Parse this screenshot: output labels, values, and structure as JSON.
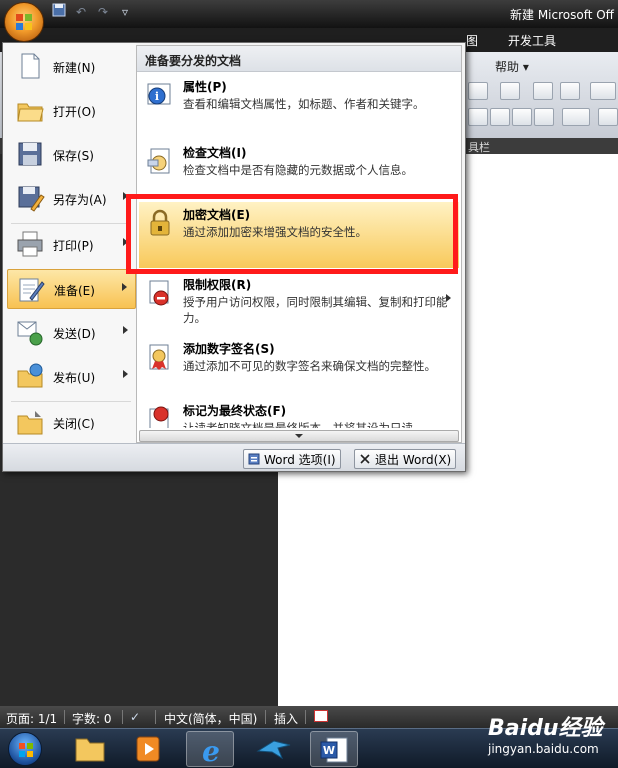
{
  "window": {
    "title": "新建 Microsoft Off",
    "quick_access": [
      "save-icon",
      "undo-icon",
      "redo-icon",
      "customize-icon"
    ]
  },
  "ribbon": {
    "tabs": [
      "图",
      "开发工具"
    ],
    "help_label": "帮助",
    "group_label": "具栏"
  },
  "office_menu": {
    "left_items": [
      {
        "label": "新建(N)",
        "icon": "new-document-icon",
        "has_submenu": false
      },
      {
        "label": "打开(O)",
        "icon": "open-folder-icon",
        "has_submenu": false
      },
      {
        "label": "保存(S)",
        "icon": "save-disk-icon",
        "has_submenu": false
      },
      {
        "label": "另存为(A)",
        "icon": "save-as-icon",
        "has_submenu": true
      },
      {
        "label": "打印(P)",
        "icon": "printer-icon",
        "has_submenu": true
      },
      {
        "label": "准备(E)",
        "icon": "prepare-icon",
        "has_submenu": true,
        "active": true
      },
      {
        "label": "发送(D)",
        "icon": "send-icon",
        "has_submenu": true
      },
      {
        "label": "发布(U)",
        "icon": "publish-icon",
        "has_submenu": true
      },
      {
        "label": "关闭(C)",
        "icon": "close-folder-icon",
        "has_submenu": false
      }
    ],
    "right_panel": {
      "title": "准备要分发的文档",
      "items": [
        {
          "title": "属性(P)",
          "desc": "查看和编辑文档属性，如标题、作者和关键字。",
          "icon": "properties-icon"
        },
        {
          "title": "检查文档(I)",
          "desc": "检查文档中是否有隐藏的元数据或个人信息。",
          "icon": "inspect-document-icon"
        },
        {
          "title": "加密文档(E)",
          "desc": "通过添加加密来增强文档的安全性。",
          "icon": "lock-icon",
          "highlighted": true
        },
        {
          "title": "限制权限(R)",
          "desc": "授予用户访问权限，同时限制其编辑、复制和打印能力。",
          "icon": "restrict-permission-icon",
          "has_submenu": true
        },
        {
          "title": "添加数字签名(S)",
          "desc": "通过添加不可见的数字签名来确保文档的完整性。",
          "icon": "digital-signature-icon"
        },
        {
          "title": "标记为最终状态(F)",
          "desc": "让读者知晓文档是最终版本，并将其设为只读。",
          "icon": "mark-final-icon"
        }
      ]
    },
    "bottom_buttons": {
      "options": "Word 选项(I)",
      "exit": "退出 Word(X)"
    }
  },
  "statusbar": {
    "page": "页面: 1/1",
    "words": "字数: 0",
    "language": "中文(简体，中国)",
    "insert_mode": "插入"
  },
  "watermark": {
    "logo": "Baidu经验",
    "url": "jingyan.baidu.com"
  },
  "colors": {
    "highlight_border": "#ff1a1a",
    "active_item": "#f8c252"
  }
}
